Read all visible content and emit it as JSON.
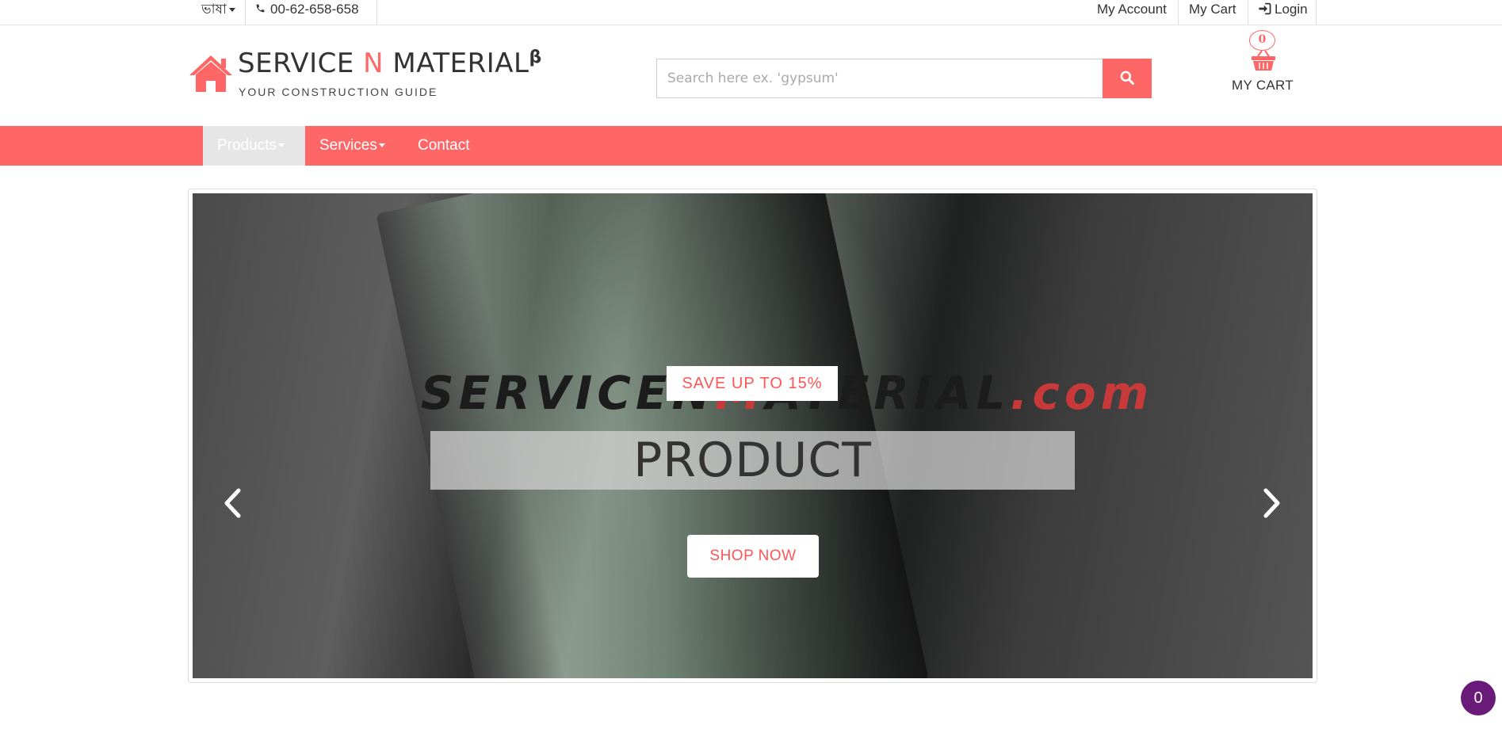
{
  "topbar": {
    "language_label": "ভাষা",
    "phone": "00-62-658-658",
    "my_account": "My Account",
    "my_cart": "My Cart",
    "login": "Login"
  },
  "header": {
    "brand_part1": "SERVICE ",
    "brand_accent": "N",
    "brand_part2": " MATERIAL",
    "brand_sup": "β",
    "tagline": "YOUR CONSTRUCTION GUIDE",
    "search_placeholder": "Search here ex. 'gypsum'",
    "cart_count": "0",
    "cart_label": "MY CART"
  },
  "nav": {
    "items": [
      {
        "label": "Products",
        "dropdown": true,
        "active": true
      },
      {
        "label": "Services",
        "dropdown": true,
        "active": false
      },
      {
        "label": "Contact",
        "dropdown": false,
        "active": false
      }
    ]
  },
  "carousel": {
    "watermark_dark": "SERVICEN",
    "watermark_dark2": "ATERIAL",
    "watermark_red": "M",
    "watermark_red2": ".com",
    "save_tag": "SAVE UP TO 15%",
    "title": "PRODUCT",
    "cta": "SHOP NOW"
  },
  "floating_badge": "0",
  "colors": {
    "brand": "#ff6666",
    "badge": "#6a1b7a"
  }
}
